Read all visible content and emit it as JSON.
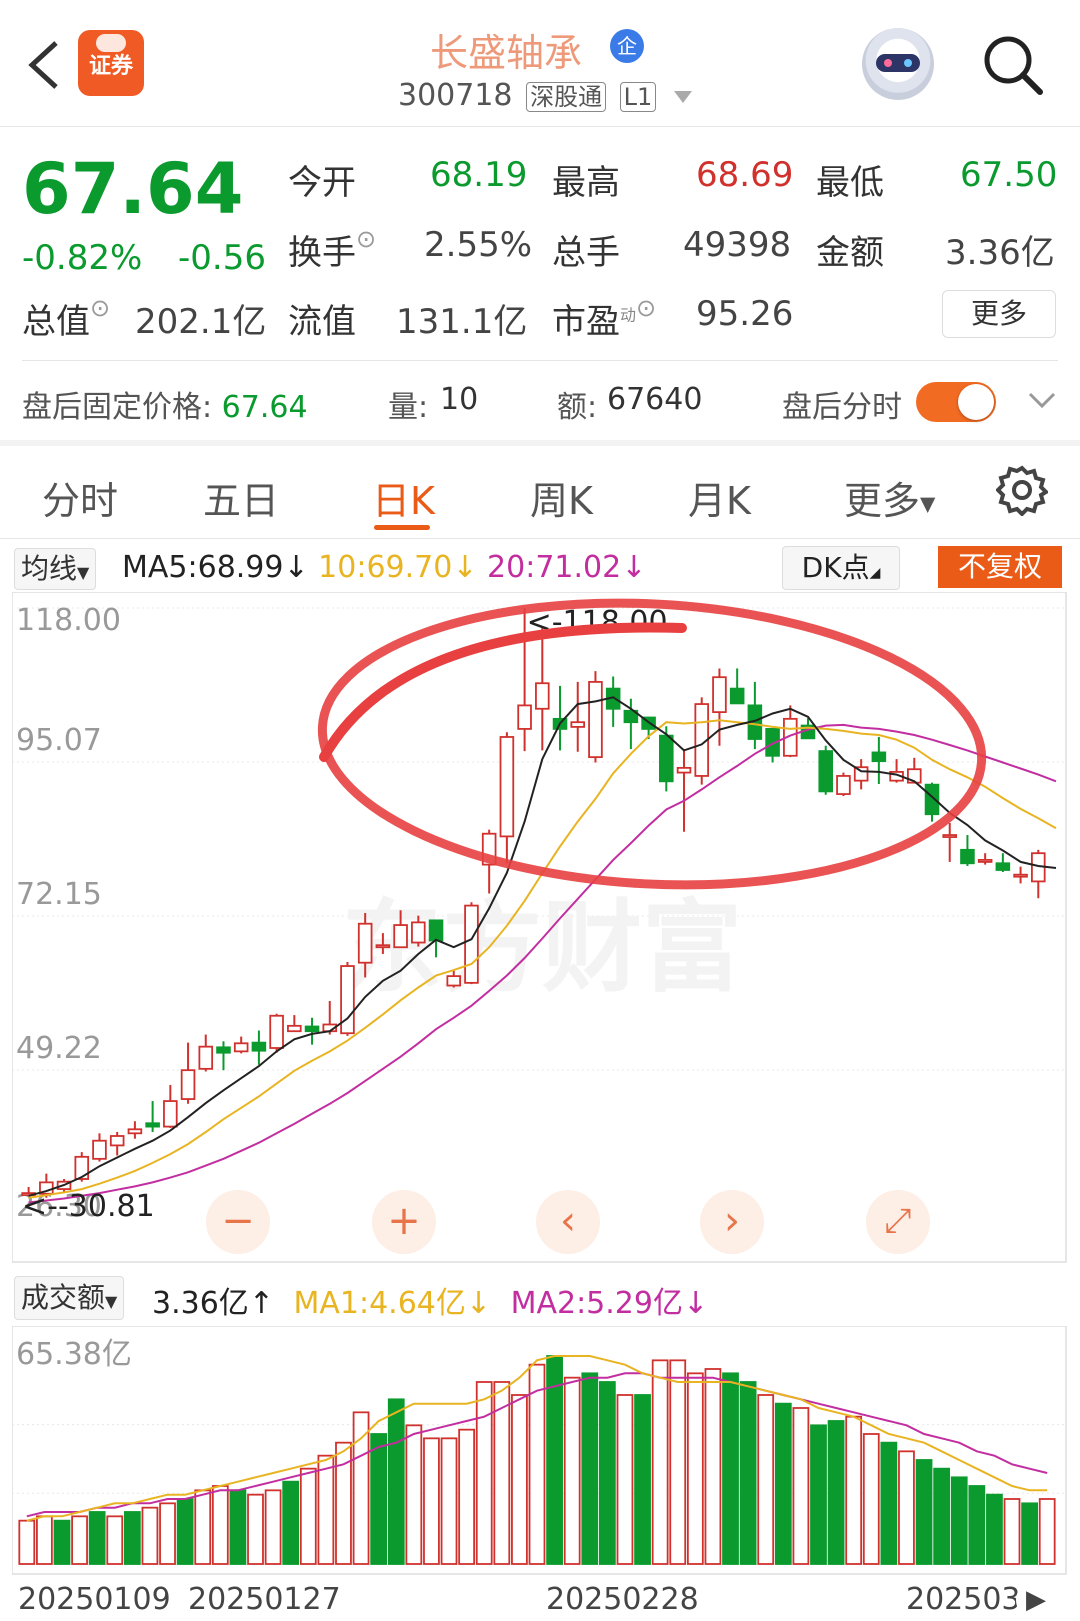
{
  "header": {
    "back_icon": "chevron-left-icon",
    "broker_logo_text": "证券",
    "stock_name": "长盛轴承",
    "enterprise_badge": "企",
    "stock_code": "300718",
    "tag_connect": "深股通",
    "tag_level": "L1",
    "robot_icon": "robot-avatar-icon",
    "search_icon": "search-icon"
  },
  "quote": {
    "price": "67.64",
    "change_pct": "-0.82%",
    "change_amt": "-0.56",
    "open_label": "今开",
    "open": "68.19",
    "high_label": "最高",
    "high": "68.69",
    "low_label": "最低",
    "low": "67.50",
    "turnover_label": "换手",
    "turnover": "2.55%",
    "volume_label": "总手",
    "volume": "49398",
    "amount_label": "金额",
    "amount": "3.36亿",
    "mcap_label": "总值",
    "mcap": "202.1亿",
    "float_label": "流值",
    "float_mcap": "131.1亿",
    "pe_label": "市盈",
    "pe_sup": "动",
    "pe": "95.26",
    "more_label": "更多"
  },
  "after_hours": {
    "price_label": "盘后固定价格:",
    "price": "67.64",
    "vol_label": "量:",
    "vol": "10",
    "amt_label": "额:",
    "amt": "67640",
    "toggle_label": "盘后分时",
    "toggle_on": true
  },
  "tabs": [
    "分时",
    "五日",
    "日K",
    "周K",
    "月K",
    "更多"
  ],
  "active_tab": "日K",
  "ma_bar": {
    "selector": "均线",
    "ma5": "MA5:68.99",
    "ma10": "10:69.70",
    "ma20": "20:71.02",
    "dk_label": "DK点",
    "fq_label": "不复权"
  },
  "price_axis": {
    "labels": [
      "118.00",
      "95.07",
      "72.15",
      "49.22",
      "26.30"
    ],
    "max_marker": "<-118.00",
    "min_marker": "<--30.81"
  },
  "watermark": "东方财富",
  "chart_controls": [
    "−",
    "+",
    "‹",
    "›",
    "⤢"
  ],
  "vol_bar": {
    "selector": "成交额",
    "value": "3.36亿",
    "ma1": "MA1:4.64亿",
    "ma2": "MA2:5.29亿",
    "axis_max": "65.38亿"
  },
  "dates": [
    "20250109",
    "20250127",
    "20250228",
    "202503"
  ],
  "colors": {
    "up": "#d0312d",
    "down": "#0a9a2e",
    "accent": "#ea5b17",
    "ma5": "#222222",
    "ma10": "#e8b422",
    "ma20": "#c22ea0",
    "annotation": "#e84040"
  },
  "chart_data": {
    "type": "candlestick",
    "ylim": [
      26.3,
      118.0
    ],
    "candles": [
      {
        "o": 30.9,
        "c": 30.9,
        "h": 31.8,
        "l": 30.5
      },
      {
        "o": 30.8,
        "c": 32.5,
        "h": 33.8,
        "l": 30.2
      },
      {
        "o": 31.5,
        "c": 32.6,
        "h": 33.0,
        "l": 30.9
      },
      {
        "o": 33.0,
        "c": 36.3,
        "h": 37.0,
        "l": 32.6
      },
      {
        "o": 36.0,
        "c": 38.7,
        "h": 39.8,
        "l": 35.6
      },
      {
        "o": 38.0,
        "c": 39.4,
        "h": 40.0,
        "l": 36.5
      },
      {
        "o": 39.8,
        "c": 40.4,
        "h": 41.6,
        "l": 39.0
      },
      {
        "o": 41.3,
        "c": 40.8,
        "h": 44.6,
        "l": 40.0
      },
      {
        "o": 40.8,
        "c": 44.6,
        "h": 47.0,
        "l": 40.6
      },
      {
        "o": 44.9,
        "c": 49.2,
        "h": 53.3,
        "l": 44.2
      },
      {
        "o": 49.4,
        "c": 52.7,
        "h": 54.5,
        "l": 49.0
      },
      {
        "o": 52.6,
        "c": 51.8,
        "h": 53.5,
        "l": 49.2
      },
      {
        "o": 52.0,
        "c": 53.2,
        "h": 54.2,
        "l": 51.7
      },
      {
        "o": 53.3,
        "c": 52.1,
        "h": 55.1,
        "l": 50.0
      },
      {
        "o": 52.5,
        "c": 57.3,
        "h": 57.6,
        "l": 51.8
      },
      {
        "o": 55.0,
        "c": 55.8,
        "h": 57.4,
        "l": 55.0
      },
      {
        "o": 55.7,
        "c": 55.0,
        "h": 57.0,
        "l": 53.0
      },
      {
        "o": 55.0,
        "c": 56.0,
        "h": 59.5,
        "l": 54.5
      },
      {
        "o": 54.7,
        "c": 64.7,
        "h": 65.3,
        "l": 54.3
      },
      {
        "o": 65.2,
        "c": 71.0,
        "h": 72.6,
        "l": 63.0
      },
      {
        "o": 67.6,
        "c": 67.8,
        "h": 69.6,
        "l": 66.5
      },
      {
        "o": 67.5,
        "c": 70.8,
        "h": 73.0,
        "l": 67.4
      },
      {
        "o": 68.2,
        "c": 71.2,
        "h": 72.2,
        "l": 67.6
      },
      {
        "o": 71.5,
        "c": 68.5,
        "h": 71.4,
        "l": 66.0
      },
      {
        "o": 61.8,
        "c": 63.2,
        "h": 64.0,
        "l": 61.5
      },
      {
        "o": 62.2,
        "c": 73.7,
        "h": 74.2,
        "l": 62.0
      },
      {
        "o": 79.8,
        "c": 84.4,
        "h": 85.0,
        "l": 75.5
      },
      {
        "o": 84.0,
        "c": 98.8,
        "h": 99.5,
        "l": 80.0
      },
      {
        "o": 100.0,
        "c": 103.5,
        "h": 118.0,
        "l": 96.7
      },
      {
        "o": 103.0,
        "c": 106.8,
        "h": 115.0,
        "l": 96.8
      },
      {
        "o": 101.5,
        "c": 100.0,
        "h": 106.4,
        "l": 96.8
      },
      {
        "o": 100.3,
        "c": 101.0,
        "h": 107.0,
        "l": 96.6
      },
      {
        "o": 95.8,
        "c": 107.0,
        "h": 108.6,
        "l": 95.0
      },
      {
        "o": 106.0,
        "c": 103.0,
        "h": 107.8,
        "l": 100.3
      },
      {
        "o": 102.7,
        "c": 101.0,
        "h": 104.5,
        "l": 97.0
      },
      {
        "o": 101.7,
        "c": 100.0,
        "h": 101.8,
        "l": 98.5
      },
      {
        "o": 99.0,
        "c": 92.2,
        "h": 100.4,
        "l": 90.7
      },
      {
        "o": 93.5,
        "c": 94.2,
        "h": 97.0,
        "l": 84.7
      },
      {
        "o": 93.0,
        "c": 103.7,
        "h": 104.7,
        "l": 91.7
      },
      {
        "o": 102.5,
        "c": 107.7,
        "h": 109.0,
        "l": 97.5
      },
      {
        "o": 106.0,
        "c": 103.8,
        "h": 109.0,
        "l": 103.8
      },
      {
        "o": 103.5,
        "c": 98.5,
        "h": 107.0,
        "l": 97.0
      },
      {
        "o": 100.0,
        "c": 96.0,
        "h": 100.0,
        "l": 95.0
      },
      {
        "o": 96.0,
        "c": 101.5,
        "h": 103.5,
        "l": 95.8
      },
      {
        "o": 100.5,
        "c": 98.6,
        "h": 101.6,
        "l": 98.5
      },
      {
        "o": 96.7,
        "c": 90.7,
        "h": 97.5,
        "l": 90.2
      },
      {
        "o": 90.3,
        "c": 93.0,
        "h": 93.5,
        "l": 90.0
      },
      {
        "o": 92.3,
        "c": 94.3,
        "h": 95.5,
        "l": 91.0
      },
      {
        "o": 96.5,
        "c": 95.2,
        "h": 98.8,
        "l": 91.8
      },
      {
        "o": 92.3,
        "c": 93.6,
        "h": 95.5,
        "l": 92.0
      },
      {
        "o": 92.0,
        "c": 94.0,
        "h": 95.7,
        "l": 92.0
      },
      {
        "o": 91.7,
        "c": 87.3,
        "h": 92.0,
        "l": 86.2
      },
      {
        "o": 84.2,
        "c": 84.2,
        "h": 86.0,
        "l": 80.2
      },
      {
        "o": 82.0,
        "c": 80.0,
        "h": 84.2,
        "l": 79.6
      },
      {
        "o": 80.5,
        "c": 80.5,
        "h": 81.5,
        "l": 79.8
      },
      {
        "o": 80.0,
        "c": 79.0,
        "h": 81.5,
        "l": 78.7
      },
      {
        "o": 78.3,
        "c": 78.3,
        "h": 79.5,
        "l": 77.0
      },
      {
        "o": 77.3,
        "c": 81.5,
        "h": 82.0,
        "l": 74.8
      }
    ],
    "ma5": [
      30.5,
      31.2,
      32.1,
      33.3,
      34.9,
      36.2,
      37.5,
      38.7,
      40.2,
      42.2,
      44.3,
      46.2,
      48.0,
      49.8,
      52.0,
      53.8,
      54.6,
      55.0,
      56.9,
      60.1,
      62.5,
      64.0,
      66.5,
      68.6,
      67.5,
      68.7,
      73.3,
      78.6,
      86.2,
      95.5,
      100.8,
      103.7,
      104.1,
      104.7,
      103.0,
      101.0,
      99.2,
      96.8,
      97.7,
      99.9,
      100.6,
      101.2,
      102.3,
      103.0,
      101.8,
      98.3,
      95.4,
      93.7,
      93.6,
      93.2,
      92.2,
      89.9,
      87.5,
      85.7,
      83.4,
      81.9,
      80.2,
      79.6,
      79.3
    ],
    "ma10": [
      30.2,
      30.6,
      31.0,
      31.5,
      32.3,
      33.2,
      34.2,
      35.4,
      36.7,
      38.2,
      40.0,
      41.9,
      43.6,
      45.3,
      47.2,
      49.1,
      50.6,
      52.0,
      53.6,
      55.5,
      57.5,
      59.6,
      61.5,
      63.3,
      64.1,
      65.0,
      67.5,
      70.7,
      74.4,
      78.5,
      82.5,
      86.2,
      89.6,
      93.4,
      96.3,
      98.9,
      101.0,
      100.8,
      101.0,
      101.3,
      101.0,
      100.7,
      100.3,
      100.0,
      100.2,
      100.0,
      99.7,
      99.3,
      99.1,
      98.4,
      97.2,
      95.4,
      94.0,
      92.8,
      91.4,
      89.7,
      88.1,
      86.7,
      85.2
    ],
    "ma20": [
      29.5,
      29.8,
      30.1,
      30.5,
      30.9,
      31.4,
      31.9,
      32.5,
      33.2,
      34.0,
      35.0,
      36.0,
      37.2,
      38.4,
      39.8,
      41.2,
      42.7,
      44.2,
      45.8,
      47.6,
      49.4,
      51.2,
      53.2,
      55.3,
      57.0,
      58.8,
      61.0,
      63.3,
      65.9,
      68.8,
      71.8,
      74.7,
      77.6,
      80.5,
      83.0,
      85.6,
      88.0,
      89.3,
      91.0,
      92.8,
      94.5,
      96.3,
      97.8,
      99.0,
      99.9,
      100.5,
      100.6,
      100.2,
      100.0,
      99.6,
      99.1,
      98.4,
      97.6,
      96.8,
      95.9,
      95.0,
      94.1,
      93.2,
      92.2
    ]
  },
  "volume_data": {
    "max": 65.38,
    "values": [
      1.0,
      1.1,
      1.0,
      1.1,
      1.2,
      1.1,
      1.2,
      1.3,
      1.4,
      1.5,
      1.7,
      1.8,
      1.7,
      1.6,
      1.7,
      1.9,
      2.2,
      2.5,
      2.8,
      3.5,
      3.0,
      3.8,
      3.2,
      2.9,
      2.9,
      3.1,
      4.2,
      4.2,
      3.9,
      4.6,
      4.8,
      4.3,
      4.4,
      4.2,
      3.9,
      3.9,
      4.7,
      4.7,
      4.4,
      4.5,
      4.4,
      4.2,
      3.9,
      3.7,
      3.6,
      3.2,
      3.3,
      3.4,
      3.0,
      2.8,
      2.6,
      2.4,
      2.2,
      2.0,
      1.8,
      1.6,
      1.5,
      1.4,
      1.5
    ],
    "up": [
      true,
      true,
      false,
      true,
      false,
      true,
      false,
      true,
      true,
      false,
      true,
      true,
      false,
      true,
      true,
      false,
      true,
      true,
      true,
      true,
      false,
      false,
      true,
      true,
      true,
      true,
      true,
      true,
      true,
      true,
      false,
      true,
      false,
      false,
      true,
      false,
      true,
      true,
      true,
      true,
      false,
      false,
      true,
      false,
      true,
      false,
      false,
      true,
      true,
      false,
      true,
      false,
      false,
      false,
      false,
      false,
      true,
      false,
      true
    ],
    "ma1": [
      1.0,
      1.1,
      1.1,
      1.2,
      1.3,
      1.4,
      1.4,
      1.5,
      1.6,
      1.6,
      1.7,
      1.8,
      1.9,
      2.0,
      2.1,
      2.2,
      2.3,
      2.4,
      2.6,
      2.9,
      3.3,
      3.5,
      3.7,
      3.7,
      3.7,
      3.7,
      3.8,
      4.0,
      4.3,
      4.7,
      4.8,
      4.8,
      4.8,
      4.7,
      4.6,
      4.4,
      4.3,
      4.2,
      4.2,
      4.2,
      4.2,
      4.1,
      4.0,
      3.9,
      3.8,
      3.6,
      3.5,
      3.4,
      3.2,
      3.0,
      2.9,
      2.8,
      2.6,
      2.4,
      2.2,
      2.0,
      1.8,
      1.7,
      1.7
    ],
    "ma2": [
      1.1,
      1.2,
      1.2,
      1.2,
      1.3,
      1.3,
      1.4,
      1.4,
      1.5,
      1.5,
      1.6,
      1.7,
      1.7,
      1.8,
      1.9,
      2.0,
      2.1,
      2.2,
      2.3,
      2.5,
      2.7,
      2.8,
      3.0,
      3.1,
      3.2,
      3.3,
      3.4,
      3.6,
      3.8,
      4.0,
      4.1,
      4.2,
      4.3,
      4.3,
      4.4,
      4.4,
      4.3,
      4.3,
      4.3,
      4.3,
      4.2,
      4.1,
      4.0,
      3.9,
      3.8,
      3.7,
      3.6,
      3.5,
      3.4,
      3.3,
      3.2,
      3.0,
      2.9,
      2.8,
      2.6,
      2.5,
      2.3,
      2.2,
      2.1
    ]
  }
}
